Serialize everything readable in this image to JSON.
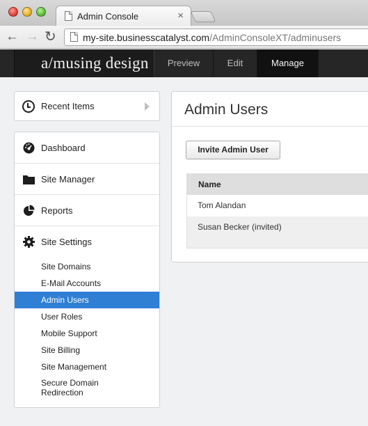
{
  "browser": {
    "tab_title": "Admin Console",
    "tab_close": "×",
    "url_host": "my-site.businesscatalyst.com",
    "url_path": "/AdminConsoleXT/adminusers",
    "back": "←",
    "forward": "→",
    "reload": "↻"
  },
  "header": {
    "logo": "a/musing design",
    "nav": {
      "preview": "Preview",
      "edit": "Edit",
      "manage": "Manage"
    },
    "active_nav": "Manage"
  },
  "sidebar": {
    "recent_items": "Recent Items",
    "items": [
      {
        "label": "Dashboard",
        "icon": "dashboard-icon"
      },
      {
        "label": "Site Manager",
        "icon": "folder-icon"
      },
      {
        "label": "Reports",
        "icon": "pie-chart-icon"
      },
      {
        "label": "Site Settings",
        "icon": "gear-icon"
      }
    ],
    "sub_items": [
      "Site Domains",
      "E-Mail Accounts",
      "Admin Users",
      "User Roles",
      "Mobile Support",
      "Site Billing",
      "Site Management",
      "Secure Domain",
      "Redirection"
    ],
    "active_sub_item": "Admin Users"
  },
  "main": {
    "title": "Admin Users",
    "invite_button": "Invite Admin User",
    "table": {
      "columns": [
        "Name"
      ],
      "rows": [
        "Tom Alandan",
        "Susan Becker (invited)"
      ]
    }
  },
  "colors": {
    "accent": "#2f7fd4",
    "header_bg": "#262626",
    "page_bg": "#f0f1f2"
  }
}
